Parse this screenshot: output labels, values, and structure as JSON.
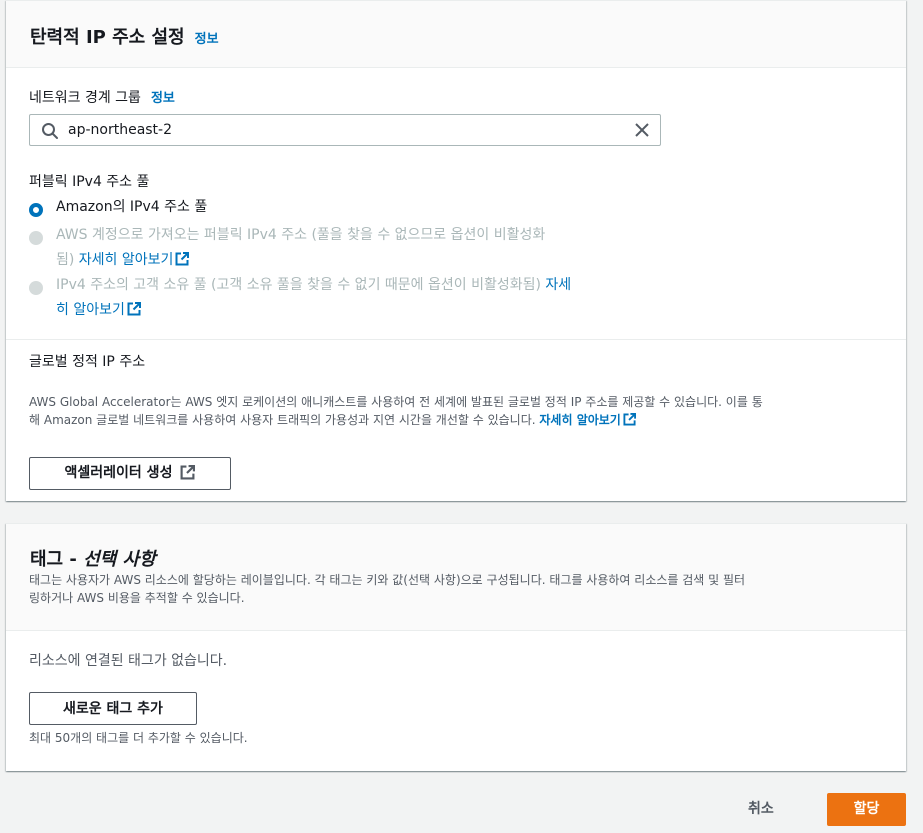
{
  "elastic_ip": {
    "title": "탄력적 IP 주소 설정",
    "info": "정보",
    "network_border_group": {
      "label": "네트워크 경계 그룹",
      "info": "정보",
      "value": "ap-northeast-2"
    },
    "ipv4_pool": {
      "label": "퍼블릭 IPv4 주소 풀",
      "options": [
        {
          "text": "Amazon의 IPv4 주소 풀",
          "selected": true
        },
        {
          "text_line1": "AWS 계정으로 가져오는 퍼블릭 IPv4 주소 (풀을 찾을 수 없으므로 옵션이 비활성화",
          "text_line2_prefix": "됨) ",
          "link": "자세히 알아보기",
          "disabled": true
        },
        {
          "text_line1_prefix": "IPv4 주소의 고객 소유 풀 (고객 소유 풀을 찾을 수 없기 때문에 옵션이 비활성화됨) ",
          "link_part1": "자세",
          "link_part2": "히 알아보기",
          "disabled": true
        }
      ]
    },
    "global_static_ip": {
      "label": "글로벌 정적 IP 주소",
      "description_line1": "AWS Global Accelerator는 AWS 엣지 로케이션의 애니캐스트를 사용하여 전 세계에 발표된 글로벌 정적 IP 주소를 제공할 수 있습니다. 이를 통",
      "description_line2": "해 Amazon 글로벌 네트워크를 사용하여 사용자 트래픽의 가용성과 지연 시간을 개선할 수 있습니다. ",
      "link": "자세히 알아보기",
      "button": "액셀러레이터 생성"
    }
  },
  "tags": {
    "title_prefix": "태그 - ",
    "title_optional": "선택 사항",
    "description_line1": "태그는 사용자가 AWS 리소스에 할당하는 레이블입니다. 각 태그는 키와 값(선택 사항)으로 구성됩니다. 태그를 사용하여 리소스를 검색 및 필터",
    "description_line2": "링하거나 AWS 비용을 추적할 수 있습니다.",
    "empty_text": "리소스에 연결된 태그가 없습니다.",
    "add_button": "새로운 태그 추가",
    "limit_text": "최대 50개의 태그를 더 추가할 수 있습니다."
  },
  "footer": {
    "cancel": "취소",
    "submit": "할당"
  },
  "colors": {
    "link": "#0073bb",
    "primary_button": "#ec7211",
    "disabled": "#aab7b8"
  }
}
